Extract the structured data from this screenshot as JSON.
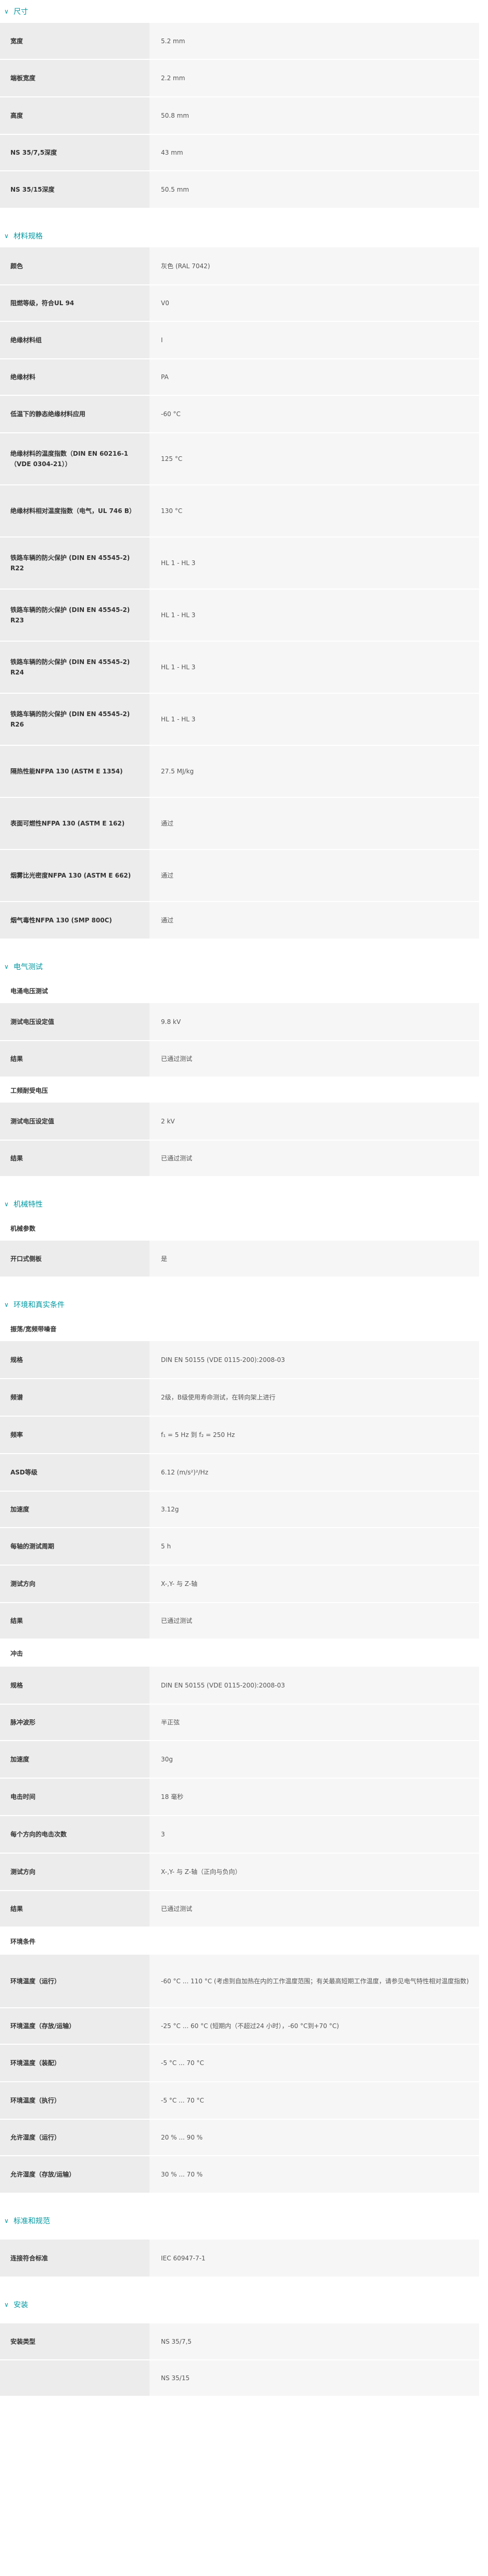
{
  "sections": {
    "dimensions": {
      "title": "尺寸",
      "rows": [
        {
          "k": "宽度",
          "v": "5.2 mm"
        },
        {
          "k": "端板宽度",
          "v": "2.2 mm"
        },
        {
          "k": "高度",
          "v": "50.8 mm"
        },
        {
          "k": "NS 35/7,5深度",
          "v": "43 mm"
        },
        {
          "k": "NS 35/15深度",
          "v": "50.5 mm"
        }
      ]
    },
    "material": {
      "title": "材料规格",
      "rows": [
        {
          "k": "颜色",
          "v": "灰色 (RAL 7042)"
        },
        {
          "k": "阻燃等级，符合UL 94",
          "v": "V0"
        },
        {
          "k": "绝缘材料组",
          "v": "I"
        },
        {
          "k": "绝缘材料",
          "v": "PA"
        },
        {
          "k": "低温下的静态绝缘材料应用",
          "v": "-60 °C"
        },
        {
          "k": "绝缘材料的温度指数（DIN EN 60216-1（VDE 0304-21））",
          "v": "125 °C"
        },
        {
          "k": "绝缘材料相对温度指数（电气，UL 746 B）",
          "v": "130 °C"
        },
        {
          "k": "铁路车辆的防火保护 (DIN EN 45545-2) R22",
          "v": "HL 1 - HL 3"
        },
        {
          "k": "铁路车辆的防火保护 (DIN EN 45545-2) R23",
          "v": "HL 1 - HL 3"
        },
        {
          "k": "铁路车辆的防火保护 (DIN EN 45545-2) R24",
          "v": "HL 1 - HL 3"
        },
        {
          "k": "铁路车辆的防火保护 (DIN EN 45545-2) R26",
          "v": "HL 1 - HL 3"
        },
        {
          "k": "隔热性能NFPA 130 (ASTM E 1354)",
          "v": "27.5 MJ/kg"
        },
        {
          "k": "表面可燃性NFPA 130 (ASTM E 162)",
          "v": "通过"
        },
        {
          "k": "烟雾比光密度NFPA 130 (ASTM E 662)",
          "v": "通过"
        },
        {
          "k": "烟气毒性NFPA 130 (SMP 800C)",
          "v": "通过"
        }
      ]
    },
    "electrical": {
      "title": "电气测试",
      "impulse": {
        "title": "电涌电压测试",
        "rows": [
          {
            "k": "测试电压设定值",
            "v": "9.8 kV"
          },
          {
            "k": "结果",
            "v": "已通过测试"
          }
        ]
      },
      "power_freq": {
        "title": "工频耐受电压",
        "rows": [
          {
            "k": "测试电压设定值",
            "v": "2 kV"
          },
          {
            "k": "结果",
            "v": "已通过测试"
          }
        ]
      }
    },
    "mechanical": {
      "title": "机械特性",
      "props": {
        "title": "机械参数",
        "rows": [
          {
            "k": "开口式侧板",
            "v": "是"
          }
        ]
      }
    },
    "environment": {
      "title": "环境和真实条件",
      "vibration": {
        "title": "振荡/宽频带噪音",
        "rows": [
          {
            "k": "规格",
            "v": "DIN EN 50155 (VDE 0115-200):2008-03"
          },
          {
            "k": "频谱",
            "v": "2级，B级使用寿命测试，在转向架上进行"
          },
          {
            "k": "频率",
            "v": "f₁ = 5 Hz 到 f₂ = 250 Hz"
          },
          {
            "k": "ASD等级",
            "v": "6.12 (m/s²)²/Hz"
          },
          {
            "k": "加速度",
            "v": "3.12g"
          },
          {
            "k": "每轴的测试周期",
            "v": "5 h"
          },
          {
            "k": "测试方向",
            "v": "X-,Y- 与 Z-轴"
          },
          {
            "k": "结果",
            "v": "已通过测试"
          }
        ]
      },
      "shock": {
        "title": "冲击",
        "rows": [
          {
            "k": "规格",
            "v": "DIN EN 50155 (VDE 0115-200):2008-03"
          },
          {
            "k": "脉冲波形",
            "v": "半正弦"
          },
          {
            "k": "加速度",
            "v": "30g"
          },
          {
            "k": "电击时间",
            "v": "18 毫秒"
          },
          {
            "k": "每个方向的电击次数",
            "v": "3"
          },
          {
            "k": "测试方向",
            "v": "X-,Y- 与 Z-轴（正向与负向）"
          },
          {
            "k": "结果",
            "v": "已通过测试"
          }
        ]
      },
      "conditions": {
        "title": "环境条件",
        "rows": [
          {
            "k": "环境温度（运行）",
            "v": "-60 °C ... 110 °C (考虑到自加热在内的工作温度范围；有关最高短期工作温度，请参见电气特性相对温度指数)"
          },
          {
            "k": "环境温度（存放/运输）",
            "v": "-25 °C ... 60 °C (短期内（不超过24 小时），-60 °C到+70 °C)"
          },
          {
            "k": "环境温度（装配）",
            "v": "-5 °C ... 70 °C"
          },
          {
            "k": "环境温度（执行）",
            "v": "-5 °C ... 70 °C"
          },
          {
            "k": "允许湿度（运行）",
            "v": "20 % ... 90 %"
          },
          {
            "k": "允许湿度（存放/运输）",
            "v": "30 % ... 70 %"
          }
        ]
      }
    },
    "standards": {
      "title": "标准和规范",
      "rows": [
        {
          "k": "连接符合标准",
          "v": "IEC 60947-7-1"
        }
      ]
    },
    "mounting": {
      "title": "安装",
      "rows": [
        {
          "k": "安装类型",
          "v": "NS 35/7,5"
        },
        {
          "k": "",
          "v": "NS 35/15"
        }
      ]
    }
  }
}
